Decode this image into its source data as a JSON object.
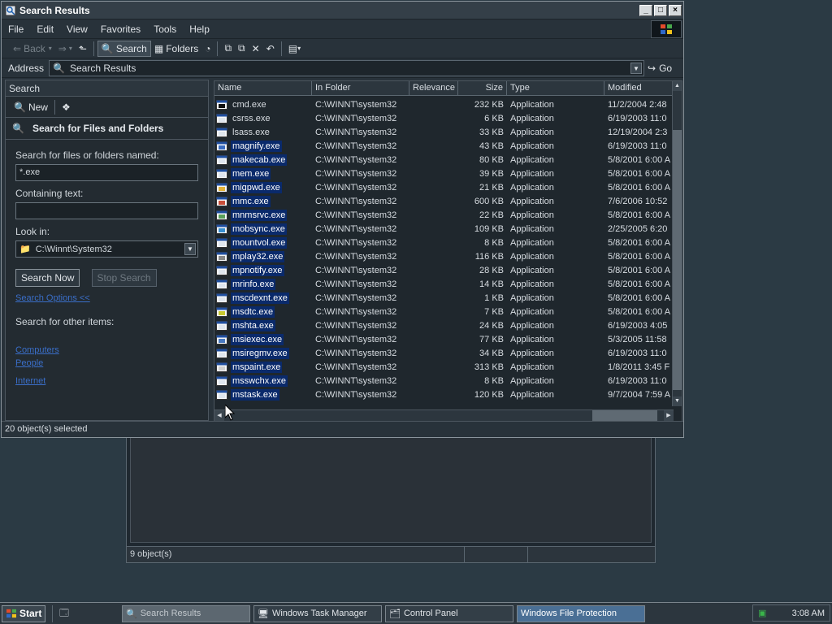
{
  "window": {
    "title": "Search Results"
  },
  "menu": [
    "File",
    "Edit",
    "View",
    "Favorites",
    "Tools",
    "Help"
  ],
  "toolbar": {
    "back": "Back",
    "search": "Search",
    "folders": "Folders"
  },
  "address": {
    "label": "Address",
    "value": "Search Results",
    "go": "Go"
  },
  "search_pane": {
    "header": "Search",
    "new_label": "New",
    "title": "Search for Files and Folders",
    "named_label": "Search for files or folders named:",
    "named_value": "*.exe",
    "containing_label": "Containing text:",
    "containing_value": "",
    "lookin_label": "Look in:",
    "lookin_value": "C:\\Winnt\\System32",
    "search_now": "Search Now",
    "stop_search": "Stop Search",
    "search_options": "Search Options <<",
    "other_items_label": "Search for other items:",
    "links": [
      "Computers",
      "People",
      "Internet"
    ]
  },
  "list": {
    "columns": [
      "Name",
      "In Folder",
      "Relevance",
      "Size",
      "Type",
      "Modified"
    ],
    "rows": [
      {
        "name": "cmd.exe",
        "folder": "C:\\WINNT\\system32",
        "size": "232 KB",
        "type": "Application",
        "modified": "11/2/2004 2:48",
        "selected": false,
        "icon": "cmd"
      },
      {
        "name": "csrss.exe",
        "folder": "C:\\WINNT\\system32",
        "size": "6 KB",
        "type": "Application",
        "modified": "6/19/2003 11:0",
        "selected": false,
        "icon": "app"
      },
      {
        "name": "lsass.exe",
        "folder": "C:\\WINNT\\system32",
        "size": "33 KB",
        "type": "Application",
        "modified": "12/19/2004 2:3",
        "selected": false,
        "icon": "app"
      },
      {
        "name": "magnify.exe",
        "folder": "C:\\WINNT\\system32",
        "size": "43 KB",
        "type": "Application",
        "modified": "6/19/2003 11:0",
        "selected": true,
        "icon": "magnify"
      },
      {
        "name": "makecab.exe",
        "folder": "C:\\WINNT\\system32",
        "size": "80 KB",
        "type": "Application",
        "modified": "5/8/2001 6:00 A",
        "selected": true,
        "icon": "app"
      },
      {
        "name": "mem.exe",
        "folder": "C:\\WINNT\\system32",
        "size": "39 KB",
        "type": "Application",
        "modified": "5/8/2001 6:00 A",
        "selected": true,
        "icon": "app"
      },
      {
        "name": "migpwd.exe",
        "folder": "C:\\WINNT\\system32",
        "size": "21 KB",
        "type": "Application",
        "modified": "5/8/2001 6:00 A",
        "selected": true,
        "icon": "key"
      },
      {
        "name": "mmc.exe",
        "folder": "C:\\WINNT\\system32",
        "size": "600 KB",
        "type": "Application",
        "modified": "7/6/2006 10:52",
        "selected": true,
        "icon": "mmc"
      },
      {
        "name": "mnmsrvc.exe",
        "folder": "C:\\WINNT\\system32",
        "size": "22 KB",
        "type": "Application",
        "modified": "5/8/2001 6:00 A",
        "selected": true,
        "icon": "net"
      },
      {
        "name": "mobsync.exe",
        "folder": "C:\\WINNT\\system32",
        "size": "109 KB",
        "type": "Application",
        "modified": "2/25/2005 6:20",
        "selected": true,
        "icon": "sync"
      },
      {
        "name": "mountvol.exe",
        "folder": "C:\\WINNT\\system32",
        "size": "8 KB",
        "type": "Application",
        "modified": "5/8/2001 6:00 A",
        "selected": true,
        "icon": "app"
      },
      {
        "name": "mplay32.exe",
        "folder": "C:\\WINNT\\system32",
        "size": "116 KB",
        "type": "Application",
        "modified": "5/8/2001 6:00 A",
        "selected": true,
        "icon": "media"
      },
      {
        "name": "mpnotify.exe",
        "folder": "C:\\WINNT\\system32",
        "size": "28 KB",
        "type": "Application",
        "modified": "5/8/2001 6:00 A",
        "selected": true,
        "icon": "app"
      },
      {
        "name": "mrinfo.exe",
        "folder": "C:\\WINNT\\system32",
        "size": "14 KB",
        "type": "Application",
        "modified": "5/8/2001 6:00 A",
        "selected": true,
        "icon": "app"
      },
      {
        "name": "mscdexnt.exe",
        "folder": "C:\\WINNT\\system32",
        "size": "1 KB",
        "type": "Application",
        "modified": "5/8/2001 6:00 A",
        "selected": true,
        "icon": "app"
      },
      {
        "name": "msdtc.exe",
        "folder": "C:\\WINNT\\system32",
        "size": "7 KB",
        "type": "Application",
        "modified": "5/8/2001 6:00 A",
        "selected": true,
        "icon": "dtc"
      },
      {
        "name": "mshta.exe",
        "folder": "C:\\WINNT\\system32",
        "size": "24 KB",
        "type": "Application",
        "modified": "6/19/2003 4:05",
        "selected": true,
        "icon": "app"
      },
      {
        "name": "msiexec.exe",
        "folder": "C:\\WINNT\\system32",
        "size": "77 KB",
        "type": "Application",
        "modified": "5/3/2005 11:58",
        "selected": true,
        "icon": "msi"
      },
      {
        "name": "msiregmv.exe",
        "folder": "C:\\WINNT\\system32",
        "size": "34 KB",
        "type": "Application",
        "modified": "6/19/2003 11:0",
        "selected": true,
        "icon": "app"
      },
      {
        "name": "mspaint.exe",
        "folder": "C:\\WINNT\\system32",
        "size": "313 KB",
        "type": "Application",
        "modified": "1/8/2011 3:45 F",
        "selected": true,
        "icon": "paint"
      },
      {
        "name": "msswchx.exe",
        "folder": "C:\\WINNT\\system32",
        "size": "8 KB",
        "type": "Application",
        "modified": "6/19/2003 11:0",
        "selected": true,
        "icon": "app"
      },
      {
        "name": "mstask.exe",
        "folder": "C:\\WINNT\\system32",
        "size": "120 KB",
        "type": "Application",
        "modified": "9/7/2004 7:59 A",
        "selected": true,
        "icon": "app"
      }
    ]
  },
  "status": "20 object(s) selected",
  "bg_window": {
    "status": "9 object(s)"
  },
  "taskbar": {
    "start": "Start",
    "tasks": [
      "Search Results",
      "Windows Task Manager",
      "Control Panel",
      "Windows File Protection"
    ],
    "clock": "3:08 AM"
  },
  "colors": {
    "selection": "#0a2a6b",
    "desktop": "#2b3a44",
    "link": "#3a6ec8"
  }
}
